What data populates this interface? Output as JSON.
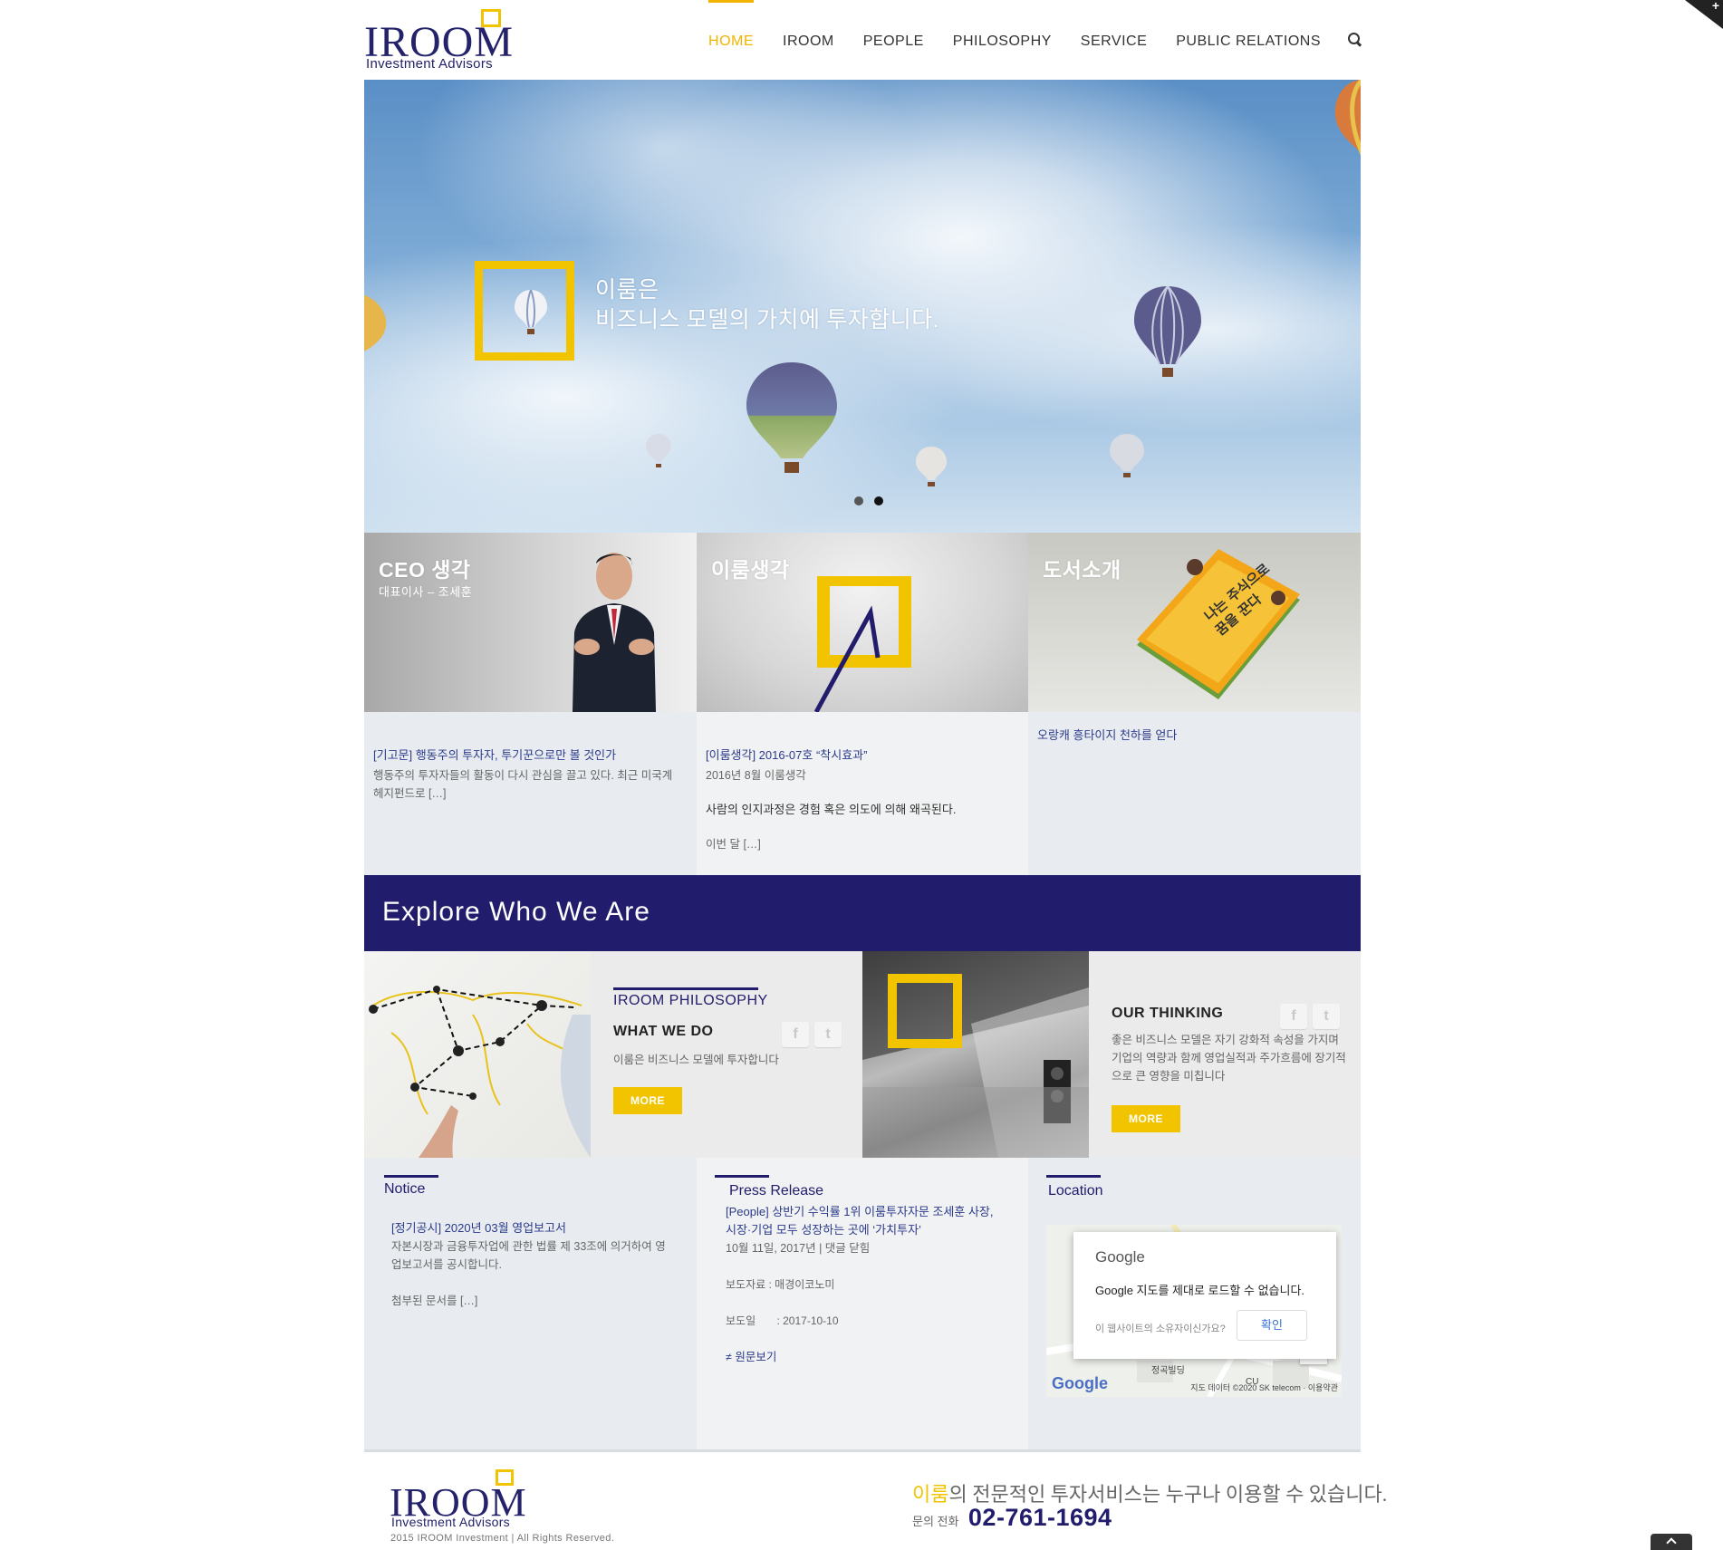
{
  "header": {
    "logo": {
      "name": "IROOM",
      "sub": "Investment Advisors"
    },
    "nav": [
      {
        "label": "HOME",
        "active": true
      },
      {
        "label": "IROOM"
      },
      {
        "label": "PEOPLE"
      },
      {
        "label": "PHILOSOPHY"
      },
      {
        "label": "SERVICE"
      },
      {
        "label": "PUBLIC RELATIONS"
      }
    ],
    "search_icon": "search-icon"
  },
  "hero": {
    "line1": "이룸은",
    "line2": "비즈니스 모델의 가치에 투자합니다.",
    "slides": 2,
    "active_slide": 2
  },
  "cards": [
    {
      "title": "CEO 생각",
      "subtitle": "대표이사 – 조세훈",
      "link": "[기고문] 행동주의 투자자, 투기꾼으로만 볼 것인가",
      "text": "행동주의 투자자들의 활동이 다시 관심을 끌고 있다. 최근 미국계 헤지펀드로 […]"
    },
    {
      "title": "이룸생각",
      "link": "[이룸생각] 2016-07호 “착시효과”",
      "meta": "2016년 8월 이룸생각",
      "strong": "사람의 인지과정은 경험 혹은 의도에 의해 왜곡된다.",
      "text": "이번 달 […]"
    },
    {
      "title": "도서소개",
      "link": "오랑캐 흥타이지 천하를 얻다"
    }
  ],
  "explore": {
    "title": "Explore  Who  We  Are",
    "philosophy": {
      "kicker": "IROOM  PHILOSOPHY",
      "head": "WHAT  WE  DO",
      "desc": "이룸은 비즈니스 모델에 투자합니다",
      "more": "MORE"
    },
    "thinking": {
      "head": "OUR  THINKING",
      "desc": "좋은 비즈니스 모델은 자기 강화적 속성을 가지며 기업의 역량과 함께 영업실적과 주가흐름에 장기적으로 큰 영향을 미칩니다",
      "more": "MORE"
    },
    "social": {
      "facebook": "f",
      "twitter": "t"
    }
  },
  "notice": {
    "title": "Notice",
    "link": "[정기공시] 2020년 03월 영업보고서",
    "text": "자본시장과 금융투자업에 관한 법률 제 33조에 의거하여 영업보고서를 공시합니다.",
    "more": "첨부된 문서를 […]"
  },
  "press": {
    "title": "Press Release",
    "link": "[People] 상반기 수익률 1위 이룸투자자문 조세훈 사장, 시장·기업 모두 성장하는 곳에 ‘가치투자’",
    "meta": "10월 11일, 2017년 |  댓글 닫힘",
    "source": "보도자료 : 매경이코노미",
    "date": "보도일       : 2017-10-10",
    "original": "원문보기"
  },
  "location": {
    "title": "Location",
    "map": {
      "google": "Google",
      "message": "Google 지도를 제대로 로드할 수 없습니다.",
      "question": "이 웹사이트의 소유자이신가요?",
      "confirm": "확인",
      "label_building": "정곡빌딩",
      "label_cu": "CU",
      "logo": "Google",
      "attribution": "지도 데이터 ©2020 SK telecom · 이용약관",
      "zoom_out": "−"
    }
  },
  "footer": {
    "logo": {
      "name": "IROOM",
      "sub": "Investment Advisors"
    },
    "copyright": "2015  IROOM  Investment  |  All  Rights  Reserved.",
    "slogan_highlight": "이룸",
    "slogan_rest": "의 전문적인 투자서비스는 누구나 이용할 수 있습니다.",
    "phone_label": "문의 전화",
    "phone": "02-761-1694"
  }
}
